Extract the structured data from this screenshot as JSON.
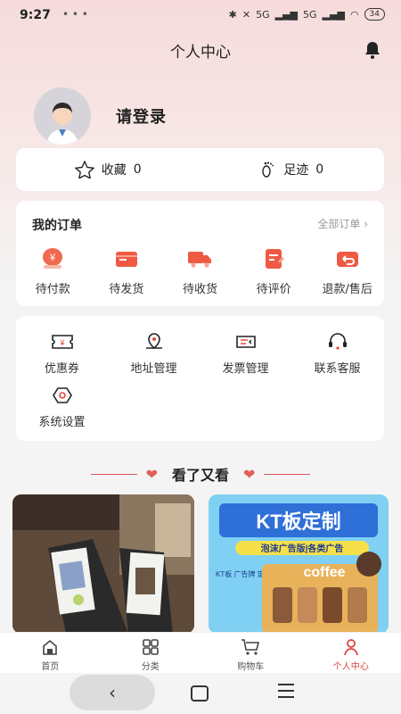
{
  "status": {
    "time": "9:27",
    "dots": "• • •",
    "signal1": "5G",
    "signal2": "5G",
    "battery": "34"
  },
  "header": {
    "title": "个人中心"
  },
  "profile": {
    "login_label": "请登录"
  },
  "stats": [
    {
      "label": "收藏",
      "count": "0",
      "icon": "star-icon"
    },
    {
      "label": "足迹",
      "count": "0",
      "icon": "footprint-icon"
    }
  ],
  "orders": {
    "title": "我的订单",
    "all_label": "全部订单",
    "items": [
      {
        "label": "待付款",
        "icon": "wallet-icon"
      },
      {
        "label": "待发货",
        "icon": "card-icon"
      },
      {
        "label": "待收货",
        "icon": "truck-icon"
      },
      {
        "label": "待评价",
        "icon": "review-icon"
      },
      {
        "label": "退款/售后",
        "icon": "refund-icon"
      }
    ]
  },
  "services": [
    {
      "label": "优惠券",
      "icon": "coupon-icon"
    },
    {
      "label": "地址管理",
      "icon": "location-icon"
    },
    {
      "label": "发票管理",
      "icon": "invoice-icon"
    },
    {
      "label": "联系客服",
      "icon": "headset-icon"
    },
    {
      "label": "系统设置",
      "icon": "settings-icon"
    }
  ],
  "recommend": {
    "title": "看了又看",
    "product2": {
      "headline": "KT板定制",
      "sub": "泡沫广告版|各类广告",
      "small": "KT板 广告牌 定制",
      "coffee": "coffee"
    }
  },
  "tabbar": [
    {
      "label": "首页",
      "icon": "home-icon"
    },
    {
      "label": "分类",
      "icon": "category-icon"
    },
    {
      "label": "购物车",
      "icon": "cart-icon"
    },
    {
      "label": "个人中心",
      "icon": "person-icon",
      "active": true
    }
  ],
  "colors": {
    "accent": "#d8443e",
    "order_icon": "#ef5a44"
  }
}
